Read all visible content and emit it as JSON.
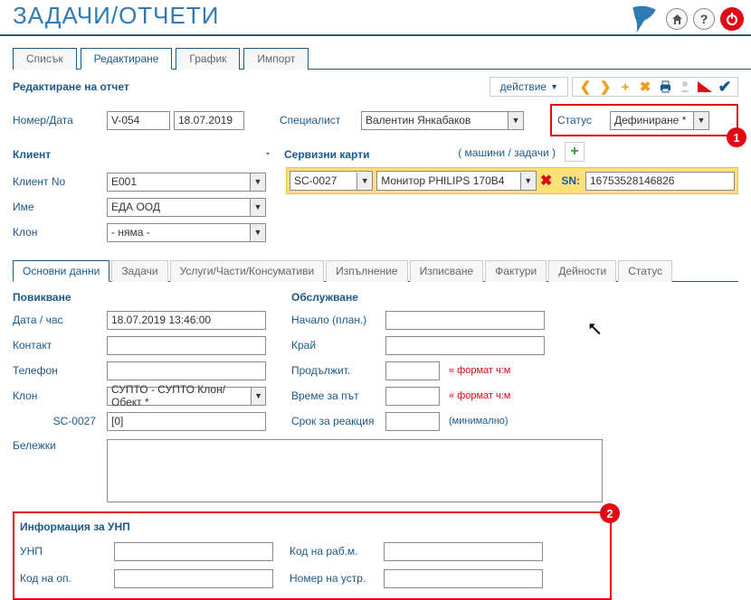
{
  "page": {
    "title": "ЗАДАЧИ/ОТЧЕТИ"
  },
  "main_tabs": {
    "list": "Списък",
    "edit": "Редактиране",
    "chart": "График",
    "import": "Импорт"
  },
  "subheader": {
    "title": "Редактиране на отчет",
    "action_label": "действие"
  },
  "form": {
    "number_date_label": "Номер/Дата",
    "number_value": "V-054",
    "date_value": "18.07.2019",
    "specialist_label": "Специалист",
    "specialist_value": "Валентин Янкабаков",
    "status_label": "Статус",
    "status_value": "Дефиниране *"
  },
  "client": {
    "heading": "Клиент",
    "dash": "-",
    "no_label": "Клиент No",
    "no_value": "E001",
    "name_label": "Име",
    "name_value": "ЕДА ООД",
    "branch_label": "Клон",
    "branch_value": "- няма -"
  },
  "service": {
    "heading": "Сервизни карти",
    "machines_link": "( машини / задачи )",
    "card_value": "SC-0027",
    "device_value": "Монитор PHILIPS 170B4",
    "sn_label": "SN:",
    "sn_value": "16753528146826"
  },
  "detail_tabs": {
    "main": "Основни данни",
    "tasks": "Задачи",
    "parts": "Услуги/Части/Консумативи",
    "exec": "Изпълнение",
    "write": "Изписване",
    "inv": "Фактури",
    "act": "Дейности",
    "stat": "Статус"
  },
  "call": {
    "heading": "Повикване",
    "datetime_label": "Дата / час",
    "datetime_value": "18.07.2019 13:46:00",
    "contact_label": "Контакт",
    "phone_label": "Телефон",
    "branch_label": "Клон",
    "branch_value": "СУПТО - СУПТО Клон/Обект *",
    "sc_label": "SC-0027",
    "sc_value": "[0]",
    "notes_label": "Бележки"
  },
  "service_block": {
    "heading": "Обслужване",
    "start_label": "Начало (план.)",
    "end_label": "Край",
    "duration_label": "Продължит.",
    "travel_label": "Време за път",
    "reaction_label": "Срок за реакция",
    "format_hint": "« формат ч:м",
    "min_hint": "(минимално)"
  },
  "unp": {
    "heading": "Информация за УНП",
    "unp_label": "УНП",
    "workplace_label": "Код на раб.м.",
    "op_label": "Код на оп.",
    "device_label": "Номер на устр."
  },
  "callouts": {
    "c1": "1",
    "c2": "2"
  }
}
